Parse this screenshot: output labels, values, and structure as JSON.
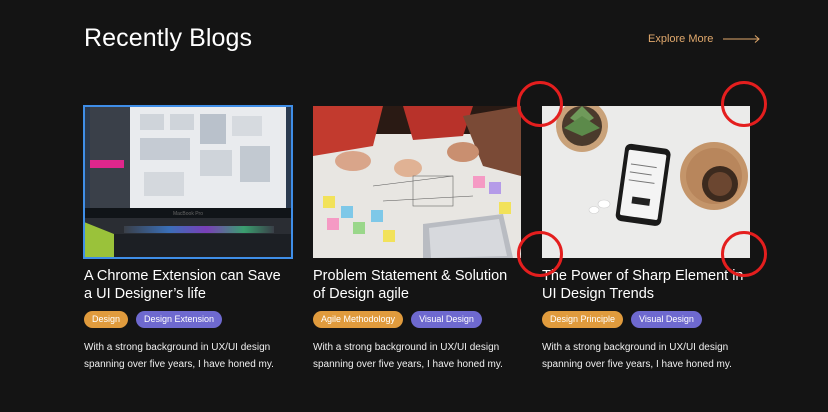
{
  "section": {
    "title": "Recently Blogs",
    "explore_label": "Explore More"
  },
  "cards": [
    {
      "title": "A Chrome Extension can Save a UI Designer’s life",
      "tags": [
        "Design",
        "Design Extension"
      ],
      "description": "With a strong background in UX/UI design spanning over five years, I have honed my.",
      "image_text": "MacBook Pro"
    },
    {
      "title": "Problem Statement & Solution of Design agile",
      "tags": [
        "Agile Methodology",
        "Visual Design"
      ],
      "description": "With a strong background in UX/UI design spanning over five years, I have honed my."
    },
    {
      "title": "The Power of Sharp Element in UI Design Trends",
      "tags": [
        "Design Principle",
        "Visual Design"
      ],
      "description": "With a strong background in UX/UI design spanning over five years, I have honed my."
    }
  ],
  "colors": {
    "background": "#141414",
    "accent": "#e0a86c",
    "tag_orange": "#e09b3d",
    "tag_purple": "#6e69cf",
    "selection": "#3f8ee8",
    "annotation": "#e41e1e"
  }
}
